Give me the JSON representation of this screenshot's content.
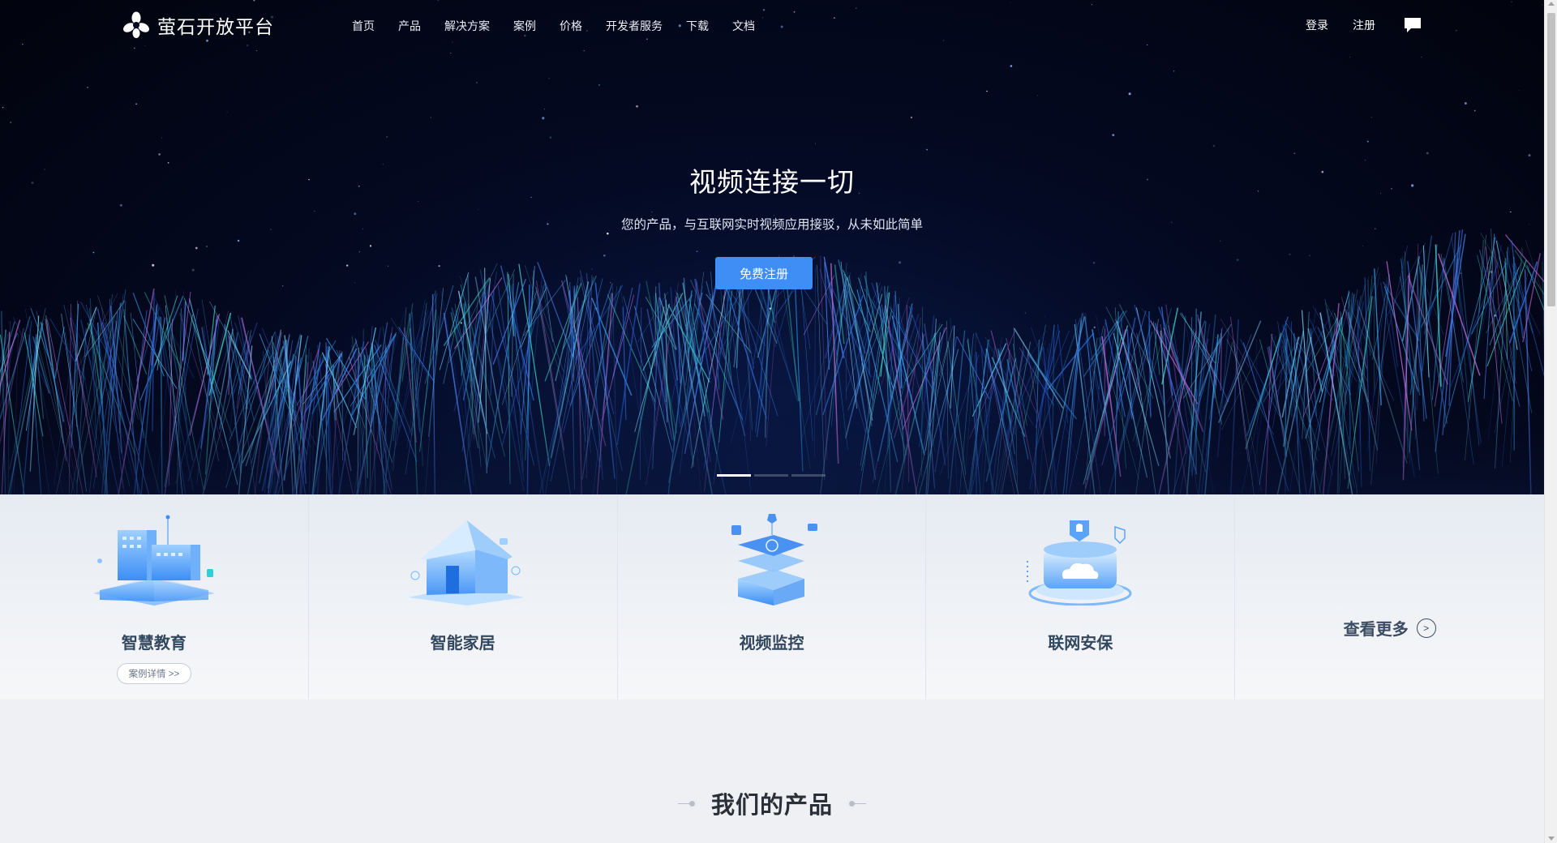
{
  "brand": {
    "name": "萤石开放平台",
    "logo_icon": "flower-logo-icon"
  },
  "nav": {
    "items": [
      "首页",
      "产品",
      "解决方案",
      "案例",
      "价格",
      "开发者服务",
      "下载",
      "文档"
    ],
    "login": "登录",
    "register": "注册",
    "chat_icon": "chat-bubble-icon"
  },
  "hero": {
    "title": "视频连接一切",
    "subtitle": "您的产品，与互联网实时视频应用接驳，从未如此简单",
    "cta": "免费注册",
    "carousel": {
      "slides": 3,
      "active": 1
    }
  },
  "categories": [
    {
      "label": "智慧教育",
      "detail": "案例详情 >>",
      "icon": "education-building-icon"
    },
    {
      "label": "智能家居",
      "icon": "smart-home-icon"
    },
    {
      "label": "视频监控",
      "icon": "video-surveillance-icon"
    },
    {
      "label": "联网安保",
      "icon": "cloud-security-icon"
    }
  ],
  "more": {
    "label": "查看更多",
    "icon": "chevron-right-circle-icon"
  },
  "products": {
    "title": "我们的产品"
  },
  "colors": {
    "accent": "#3f8ef6",
    "hero_bg": "#040a24",
    "label": "#33475f"
  }
}
